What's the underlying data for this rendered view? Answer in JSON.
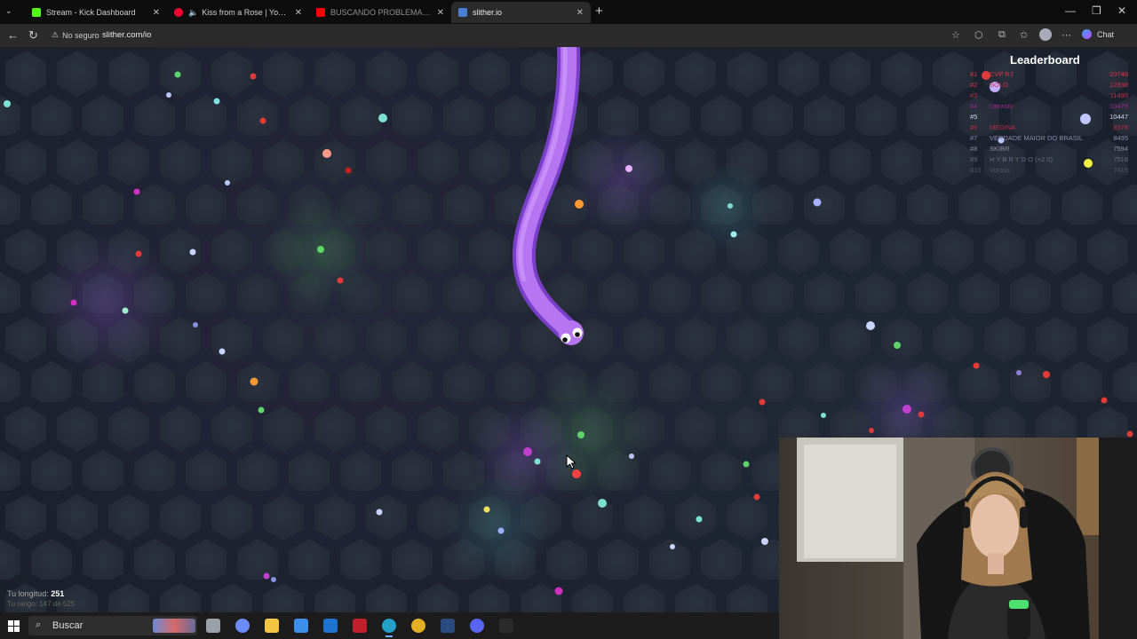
{
  "browser": {
    "tabs": [
      {
        "title": "Stream - Kick Dashboard",
        "favicon": "kick-icon",
        "color": "#53fc18",
        "active": false
      },
      {
        "title": "Kiss from a Rose | YouTube Music",
        "favicon": "youtube-music-icon",
        "color": "#ff0033",
        "active": false,
        "audio": true
      },
      {
        "title": "BUSCANDO PROBLEMAS EN EL M",
        "favicon": "youtube-icon",
        "color": "#ff0000",
        "active": false
      },
      {
        "title": "slither.io",
        "favicon": "slither-icon",
        "color": "#4a7fd6",
        "active": true
      }
    ],
    "security_label": "No seguro",
    "url": "slither.com/io",
    "chat_label": "Chat"
  },
  "game": {
    "leaderboard": {
      "title": "Leaderboard",
      "rows": [
        {
          "rank": "#1",
          "name": "CVP RJ",
          "score": "20748",
          "color": "#e0304a"
        },
        {
          "rank": "#2",
          "name": "SOLO",
          "score": "12838",
          "color": "#d8304a"
        },
        {
          "rank": "#3",
          "name": "",
          "score": "11495",
          "color": "#b8304a"
        },
        {
          "rank": "#4",
          "name": "catrasto",
          "score": "10479",
          "color": "#9a2a8a"
        },
        {
          "rank": "#5",
          "name": "",
          "score": "10447",
          "color": "#cfd6ea"
        },
        {
          "rank": "#6",
          "name": "MEDINA",
          "score": "8378",
          "color": "#b8304a"
        },
        {
          "rank": "#7",
          "name": "VERDADE MAIOR DO BRASIL",
          "score": "8495",
          "color": "#8a8ab0"
        },
        {
          "rank": "#8",
          "name": "SKIBR",
          "score": "7594",
          "color": "#8a8a9a"
        },
        {
          "rank": "#9",
          "name": "H Y B R Y D O (+2 0)",
          "score": "7516",
          "color": "#6a6a80"
        },
        {
          "rank": "#10",
          "name": "Vorass",
          "score": "7415",
          "color": "#55566a"
        }
      ]
    },
    "stats": {
      "length_label": "Tu longitud:",
      "length_value": "251",
      "rank_text": "Tu rango: 147 de 525"
    }
  },
  "taskbar": {
    "search_placeholder": "Buscar",
    "apps": [
      {
        "name": "task-view-icon",
        "color": "#9aa0a8",
        "active": false
      },
      {
        "name": "copilot-icon",
        "color": "#6b8cff",
        "active": false
      },
      {
        "name": "file-explorer-icon",
        "color": "#f4c542",
        "active": false
      },
      {
        "name": "store-icon",
        "color": "#3d8ee8",
        "active": false
      },
      {
        "name": "outlook-icon",
        "color": "#1e72d0",
        "active": false
      },
      {
        "name": "obs-icon",
        "color": "#c0202a",
        "active": false
      },
      {
        "name": "edge-icon",
        "color": "#24a0c8",
        "active": true
      },
      {
        "name": "chrome-icon",
        "color": "#e3b024",
        "active": false
      },
      {
        "name": "steam-icon",
        "color": "#2a4a80",
        "active": false
      },
      {
        "name": "discord-icon",
        "color": "#5865f2",
        "active": false
      },
      {
        "name": "streamlabs-icon",
        "color": "#2a2a2a",
        "active": false
      }
    ]
  }
}
